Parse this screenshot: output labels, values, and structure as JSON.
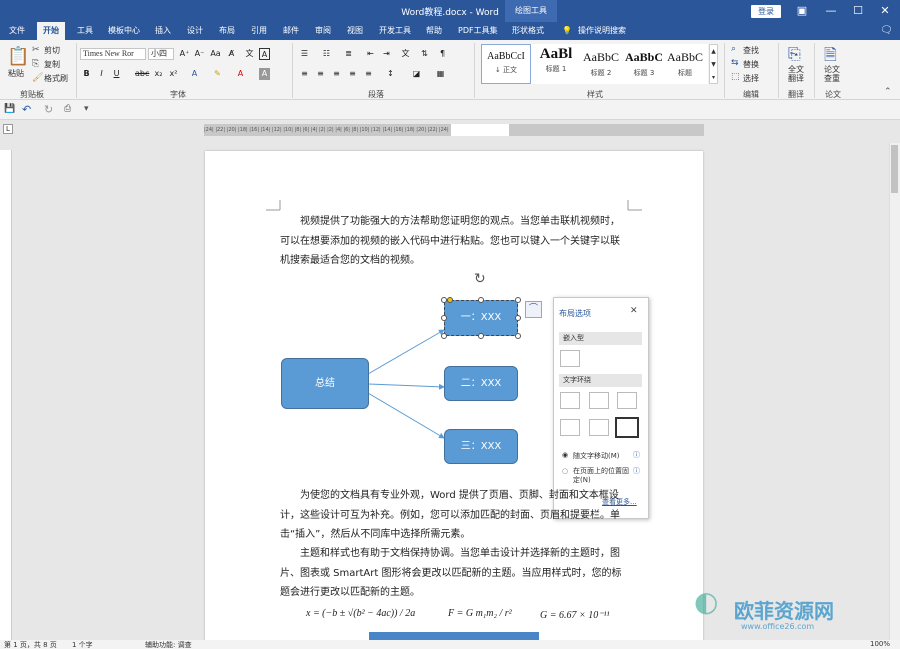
{
  "app": {
    "title": "Word教程.docx - Word",
    "contextual_tab": "绘图工具",
    "login": "登录"
  },
  "tabs": [
    "文件",
    "开始",
    "工具",
    "模板中心",
    "插入",
    "设计",
    "布局",
    "引用",
    "邮件",
    "审阅",
    "视图",
    "开发工具",
    "帮助",
    "PDF工具集",
    "形状格式",
    "操作说明搜索"
  ],
  "ribbon": {
    "clipboard": {
      "paste": "粘贴",
      "cut": "剪切",
      "copy": "复制",
      "format_painter": "格式刷",
      "label": "剪贴板"
    },
    "font": {
      "name": "Times New Ror",
      "size": "小四",
      "label": "字体"
    },
    "paragraph": {
      "label": "段落"
    },
    "styles": {
      "label": "样式",
      "items": [
        {
          "sample": "AaBbCcI",
          "name": "↓ 正文"
        },
        {
          "sample": "AaBl",
          "name": "标题 1"
        },
        {
          "sample": "AaBbC",
          "name": "标题 2"
        },
        {
          "sample": "AaBbC",
          "name": "标题 3"
        },
        {
          "sample": "AaBbC",
          "name": "标题"
        }
      ]
    },
    "editing": {
      "find": "查找",
      "replace": "替换",
      "select": "选择",
      "label": "编辑"
    },
    "translate": {
      "btn": "全文\n翻译",
      "label": "翻译"
    },
    "paper": {
      "btn": "论文\n查重",
      "label": "论文"
    }
  },
  "ruler_text": "|24| |22| |20| |18| |16| |14| |12| |10|  |8|  |6|  |4|  |2|   |2|  |4|  |6|  |8|  |10| |12| |14| |16| |18| |20| |22| |24|",
  "document": {
    "para1": "视频提供了功能强大的方法帮助您证明您的观点。当您单击联机视频时，可以在想要添加的视频的嵌入代码中进行粘贴。您也可以键入一个关键字以联机搜索最适合您的文档的视频。",
    "para2": "为使您的文档具有专业外观，Word 提供了页眉、页脚、封面和文本框设计，这些设计可互为补充。例如，您可以添加匹配的封面、页眉和提要栏。单击“插入”，然后从不同库中选择所需元素。",
    "para3": "主题和样式也有助于文档保持协调。当您单击设计并选择新的主题时，图片、图表或 SmartArt 图形将会更改以匹配新的主题。当应用样式时，您的标题会进行更改以匹配新的主题。",
    "diagram": {
      "root": "总结",
      "node1": "一：XXX",
      "node2": "二：XXX",
      "node3": "三：XXX"
    },
    "formula1": "x = (−b ± √(b² − 4ac)) / 2a",
    "formula2": "F = G m₁m₂ / r²",
    "formula3": "G = 6.67 × 10⁻¹¹"
  },
  "layout_panel": {
    "title": "布局选项",
    "inline_label": "嵌入型",
    "wrap_label": "文字环绕",
    "opt_move": "随文字移动(M)",
    "opt_fixed": "在页面上的位置固定(N)",
    "more": "查看更多..."
  },
  "status": {
    "page": "第 1 页，共 8 页",
    "words": "1 个字",
    "accessibility": "辅助功能: 调查",
    "zoom": "100%"
  },
  "watermark": {
    "cn": "欧菲资源网",
    "url": "www.office26.com"
  },
  "colors": {
    "titlebar": "#2b579a",
    "shape_fill": "#5b9bd5",
    "arrow": "#5b9bd5"
  }
}
